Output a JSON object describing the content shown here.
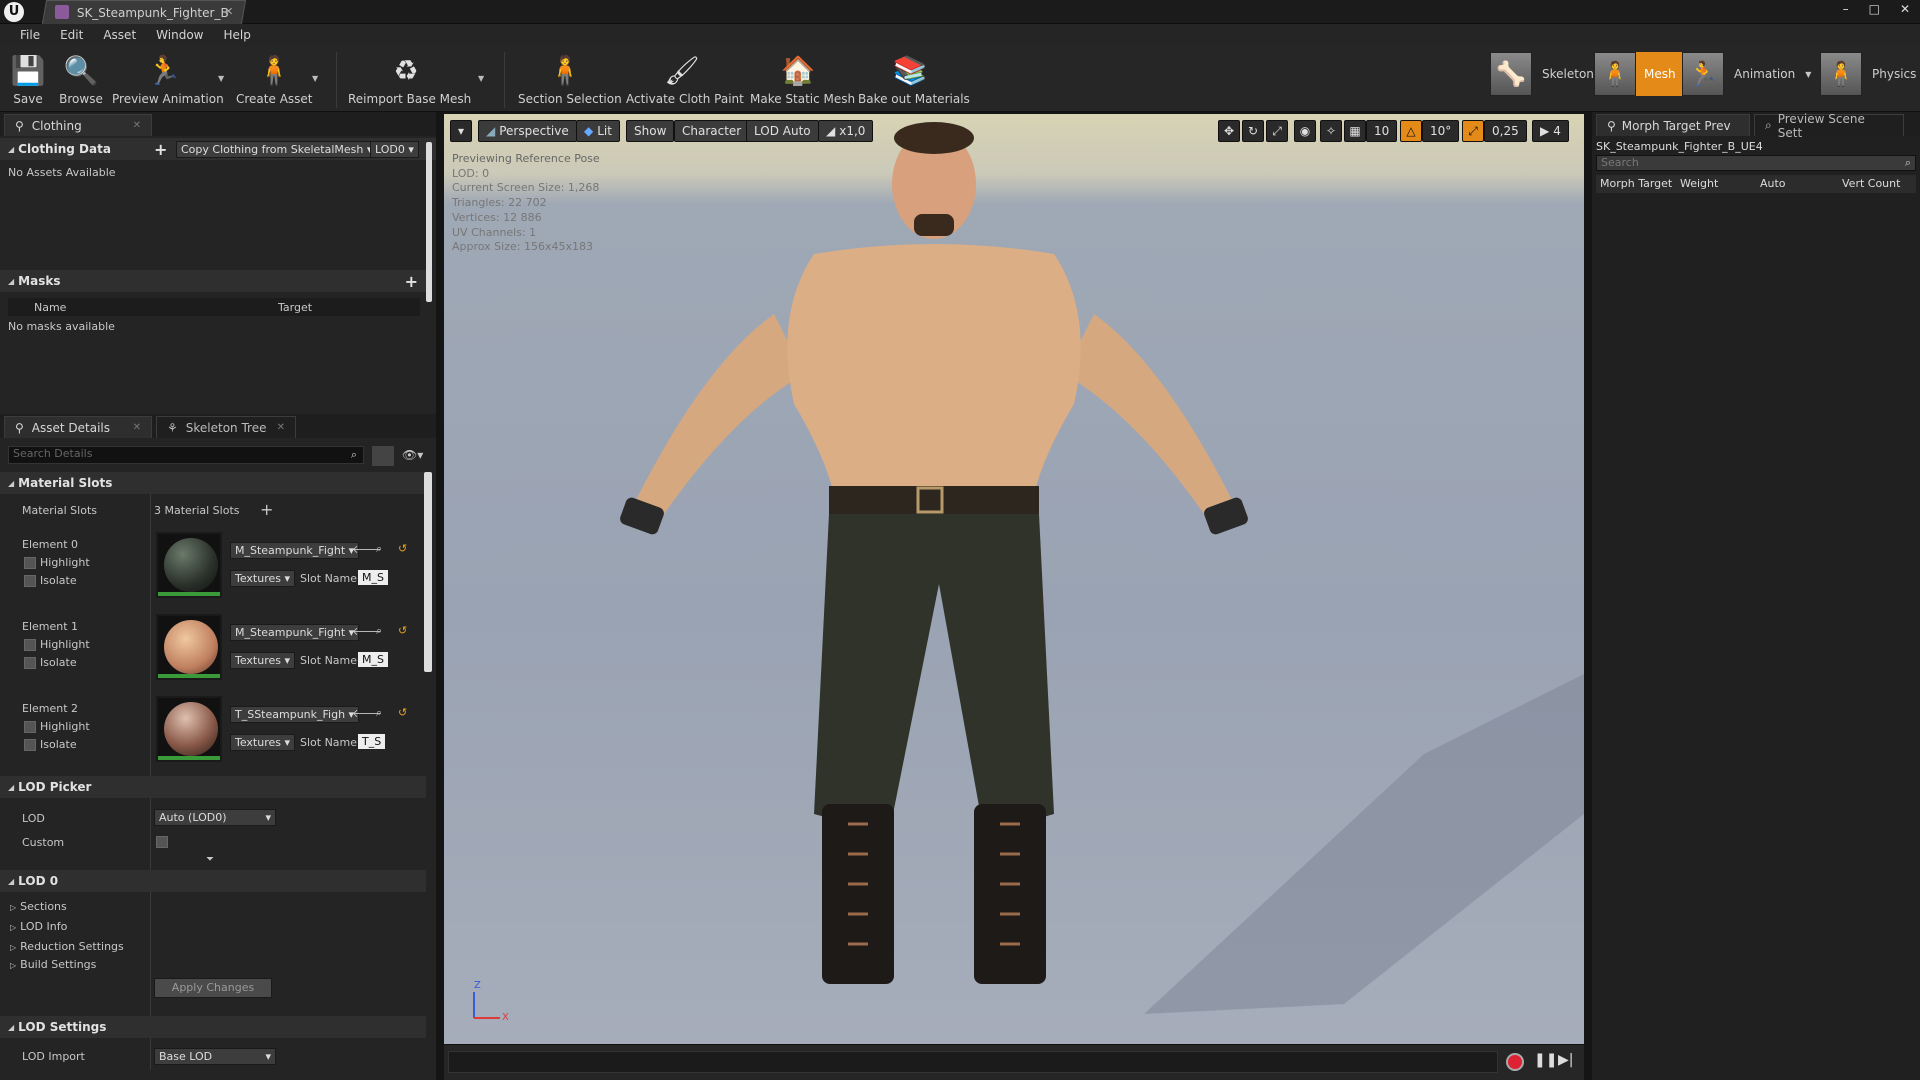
{
  "window": {
    "title": "SK_Steampunk_Fighter_B",
    "controls": [
      "–",
      "□",
      "✕"
    ]
  },
  "menu": [
    "File",
    "Edit",
    "Asset",
    "Window",
    "Help"
  ],
  "toolbar": {
    "save": "Save",
    "browse": "Browse",
    "preview_animation": "Preview Animation",
    "create_asset": "Create Asset",
    "reimport": "Reimport Base Mesh",
    "section_selection": "Section Selection",
    "activate_cloth": "Activate Cloth Paint",
    "make_static": "Make Static Mesh",
    "bake_out": "Bake out Materials"
  },
  "modes": {
    "skeleton": "Skeleton",
    "mesh": "Mesh",
    "animation": "Animation",
    "physics": "Physics"
  },
  "clothing_panel": {
    "tab": "Clothing",
    "section": "Clothing Data",
    "copy_btn": "Copy Clothing from SkeletalMesh",
    "lod_dd": "LOD0",
    "empty": "No Assets Available",
    "masks": "Masks",
    "col_name": "Name",
    "col_target": "Target",
    "masks_empty": "No masks available"
  },
  "details": {
    "tab_details": "Asset Details",
    "tab_skeleton": "Skeleton Tree",
    "search_placeholder": "Search Details",
    "material_slots_section": "Material Slots",
    "material_slots_label": "Material Slots",
    "material_slots_count": "3 Material Slots",
    "highlight": "Highlight",
    "isolate": "Isolate",
    "textures": "Textures",
    "slot_name": "Slot Name",
    "elements": [
      {
        "label": "Element 0",
        "material": "M_Steampunk_Fight",
        "slot": "M_S"
      },
      {
        "label": "Element 1",
        "material": "M_Steampunk_Fight",
        "slot": "M_S"
      },
      {
        "label": "Element 2",
        "material": "T_SSteampunk_Figh",
        "slot": "T_S"
      }
    ],
    "lod_picker": "LOD Picker",
    "lod_label": "LOD",
    "lod_value": "Auto (LOD0)",
    "custom": "Custom",
    "lod0": "LOD 0",
    "sections": "Sections",
    "lod_info": "LOD Info",
    "reduction": "Reduction Settings",
    "build": "Build Settings",
    "apply": "Apply Changes",
    "lod_settings": "LOD Settings",
    "lod_import": "LOD Import",
    "lod_import_value": "Base LOD"
  },
  "viewport": {
    "perspective": "Perspective",
    "lit": "Lit",
    "show": "Show",
    "character": "Character",
    "lod_auto": "LOD Auto",
    "speed": "x1,0",
    "grid": "10",
    "angle": "10°",
    "scale": "0,25",
    "cam": "4",
    "info": [
      "Previewing Reference Pose",
      "LOD: 0",
      "Current Screen Size: 1,268",
      "Triangles: 22 702",
      "Vertices: 12 886",
      "UV Channels: 1",
      "Approx Size: 156x45x183"
    ],
    "axis_z": "Z",
    "axis_x": "X"
  },
  "morph_panel": {
    "tab1": "Morph Target Prev",
    "tab2": "Preview Scene Sett",
    "asset": "SK_Steampunk_Fighter_B_UE4",
    "search_placeholder": "Search",
    "col_morph": "Morph Target",
    "col_weight": "Weight",
    "col_auto": "Auto",
    "col_vert": "Vert Count"
  },
  "colors": {
    "accent": "#e48a18",
    "panel": "#242424",
    "header": "#2f2f2f"
  }
}
